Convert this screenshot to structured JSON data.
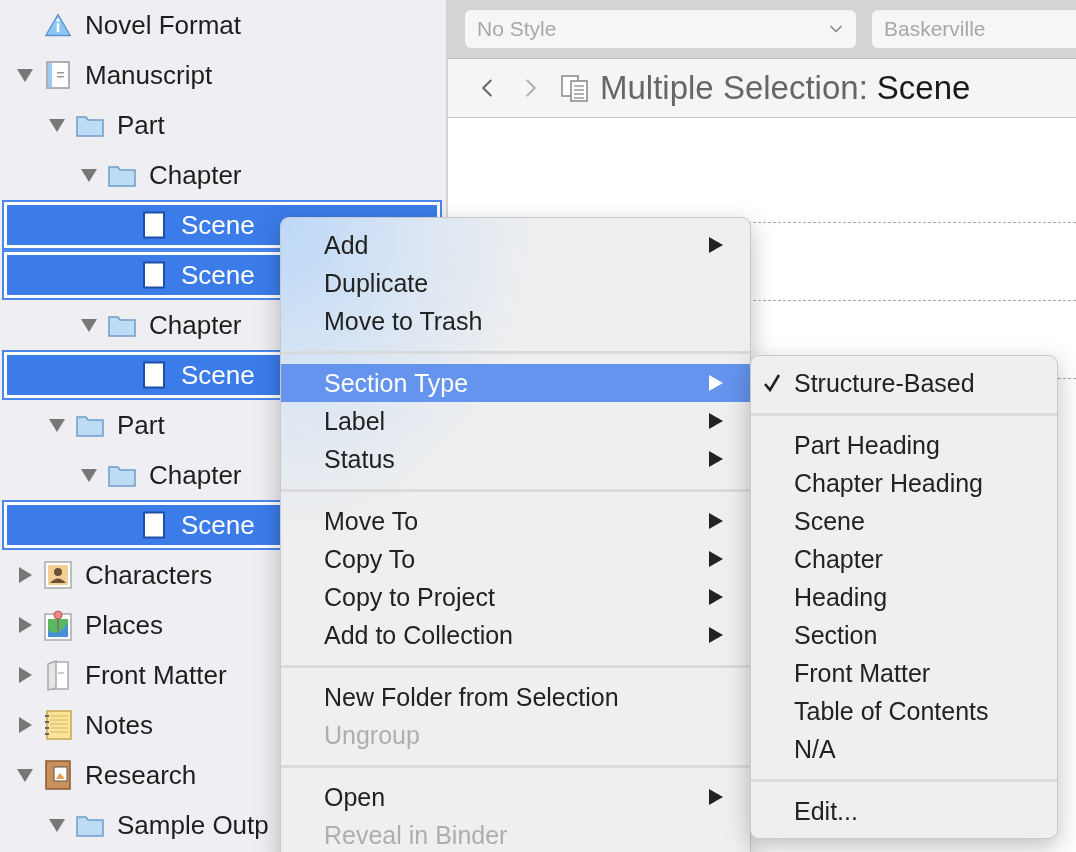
{
  "binder": {
    "items": [
      {
        "label": "Novel Format",
        "kind": "info",
        "selected": false
      },
      {
        "label": "Manuscript",
        "kind": "manuscript",
        "expanded": true,
        "selected": false,
        "children": [
          {
            "label": "Part",
            "kind": "folder",
            "expanded": true,
            "selected": false,
            "children": [
              {
                "label": "Chapter",
                "kind": "folder",
                "expanded": true,
                "selected": false,
                "children": [
                  {
                    "label": "Scene",
                    "kind": "document",
                    "selected": true
                  },
                  {
                    "label": "Scene",
                    "kind": "document",
                    "selected": true
                  }
                ]
              },
              {
                "label": "Chapter",
                "kind": "folder",
                "expanded": true,
                "selected": false,
                "children": [
                  {
                    "label": "Scene",
                    "kind": "document",
                    "selected": true
                  }
                ]
              }
            ]
          },
          {
            "label": "Part",
            "kind": "folder",
            "expanded": true,
            "selected": false,
            "children": [
              {
                "label": "Chapter",
                "kind": "folder",
                "expanded": true,
                "selected": false,
                "children": [
                  {
                    "label": "Scene",
                    "kind": "document",
                    "selected": true
                  }
                ]
              }
            ]
          }
        ]
      },
      {
        "label": "Characters",
        "kind": "characters",
        "expanded": false,
        "selected": false
      },
      {
        "label": "Places",
        "kind": "places",
        "expanded": false,
        "selected": false
      },
      {
        "label": "Front Matter",
        "kind": "front-matter",
        "expanded": false,
        "selected": false
      },
      {
        "label": "Notes",
        "kind": "notes",
        "expanded": false,
        "selected": false
      },
      {
        "label": "Research",
        "kind": "research",
        "expanded": true,
        "selected": false,
        "children": [
          {
            "label": "Sample Outp",
            "kind": "folder",
            "expanded": true,
            "selected": false
          }
        ]
      }
    ]
  },
  "toolbar": {
    "style_select": {
      "value": "No Style",
      "disabled": true
    },
    "font_select": {
      "value": "Baskerville",
      "disabled": true
    }
  },
  "header": {
    "back": {
      "disabled": false
    },
    "forward": {
      "disabled": true
    },
    "prefix": "Multiple Selection:",
    "title": "Scene"
  },
  "context_menu": {
    "groups": [
      [
        {
          "label": "Add",
          "submenu": true,
          "disabled": false,
          "selected": false
        },
        {
          "label": "Duplicate",
          "submenu": false,
          "disabled": false,
          "selected": false
        },
        {
          "label": "Move to Trash",
          "submenu": false,
          "disabled": false,
          "selected": false
        }
      ],
      [
        {
          "label": "Section Type",
          "submenu": true,
          "disabled": false,
          "selected": true
        },
        {
          "label": "Label",
          "submenu": true,
          "disabled": false,
          "selected": false
        },
        {
          "label": "Status",
          "submenu": true,
          "disabled": false,
          "selected": false
        }
      ],
      [
        {
          "label": "Move To",
          "submenu": true,
          "disabled": false,
          "selected": false
        },
        {
          "label": "Copy To",
          "submenu": true,
          "disabled": false,
          "selected": false
        },
        {
          "label": "Copy to Project",
          "submenu": true,
          "disabled": false,
          "selected": false
        },
        {
          "label": "Add to Collection",
          "submenu": true,
          "disabled": false,
          "selected": false
        }
      ],
      [
        {
          "label": "New Folder from Selection",
          "submenu": false,
          "disabled": false,
          "selected": false
        },
        {
          "label": "Ungroup",
          "submenu": false,
          "disabled": true,
          "selected": false
        }
      ],
      [
        {
          "label": "Open",
          "submenu": true,
          "disabled": false,
          "selected": false
        },
        {
          "label": "Reveal in Binder",
          "submenu": false,
          "disabled": true,
          "selected": false
        }
      ]
    ]
  },
  "section_type_menu": {
    "groups": [
      [
        {
          "label": "Structure-Based",
          "checked": true
        }
      ],
      [
        {
          "label": "Part Heading",
          "checked": false
        },
        {
          "label": "Chapter Heading",
          "checked": false
        },
        {
          "label": "Scene",
          "checked": false
        },
        {
          "label": "Chapter",
          "checked": false
        },
        {
          "label": "Heading",
          "checked": false
        },
        {
          "label": "Section",
          "checked": false
        },
        {
          "label": "Front Matter",
          "checked": false
        },
        {
          "label": "Table of Contents",
          "checked": false
        },
        {
          "label": "N/A",
          "checked": false
        }
      ],
      [
        {
          "label": "Edit...",
          "checked": false
        }
      ]
    ]
  }
}
